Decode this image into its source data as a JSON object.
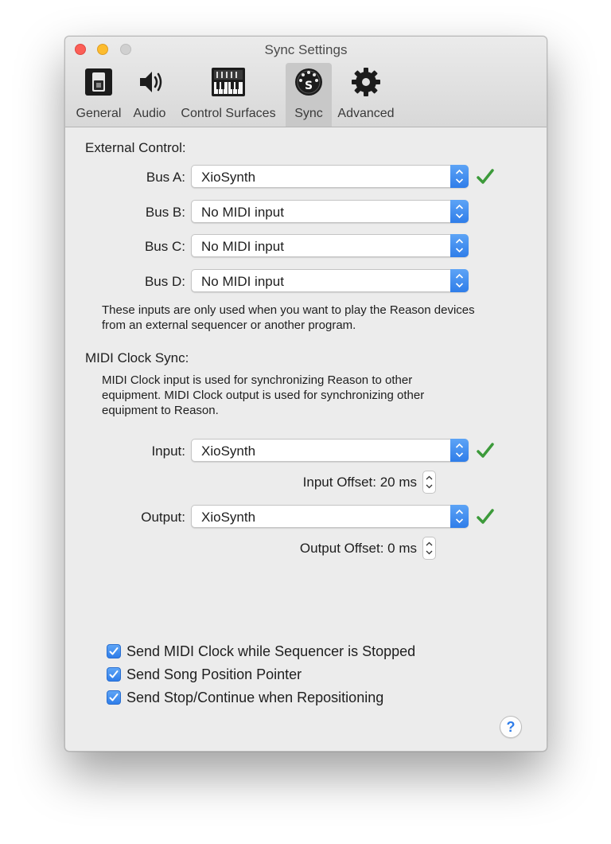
{
  "window": {
    "title": "Sync Settings"
  },
  "tabs": [
    {
      "label": "General",
      "icon": "switch-icon"
    },
    {
      "label": "Audio",
      "icon": "speaker-icon"
    },
    {
      "label": "Control Surfaces",
      "icon": "keyboard-icon"
    },
    {
      "label": "Sync",
      "icon": "midi-plug-icon"
    },
    {
      "label": "Advanced",
      "icon": "gear-icon"
    }
  ],
  "active_tab": "Sync",
  "external_control": {
    "title": "External Control:",
    "buses": [
      {
        "label": "Bus A:",
        "value": "XioSynth",
        "ok": true
      },
      {
        "label": "Bus B:",
        "value": "No MIDI input",
        "ok": false
      },
      {
        "label": "Bus C:",
        "value": "No MIDI input",
        "ok": false
      },
      {
        "label": "Bus D:",
        "value": "No MIDI input",
        "ok": false
      }
    ],
    "note_line1": "These inputs are only used when you want to play the Reason devices",
    "note_line2": "from an external sequencer or another program."
  },
  "midi_clock": {
    "title": "MIDI Clock Sync:",
    "desc_line1": "MIDI Clock input is used for synchronizing Reason to other",
    "desc_line2": "equipment. MIDI Clock output is used for synchronizing other",
    "desc_line3": "equipment to Reason.",
    "input_label": "Input:",
    "input_value": "XioSynth",
    "input_offset": "Input Offset: 20 ms",
    "output_label": "Output:",
    "output_value": "XioSynth",
    "output_offset": "Output Offset: 0 ms"
  },
  "options": [
    {
      "label": "Send MIDI Clock while Sequencer is Stopped",
      "checked": true
    },
    {
      "label": "Send Song Position Pointer",
      "checked": true
    },
    {
      "label": "Send Stop/Continue when Repositioning",
      "checked": true
    }
  ],
  "help": {
    "label": "?"
  },
  "colors": {
    "accent": "#2f7de9",
    "ok_check": "#3c9a3a",
    "close": "#fc5f57",
    "minimize": "#fdbc2e",
    "zoom": "#d0d0d0"
  }
}
